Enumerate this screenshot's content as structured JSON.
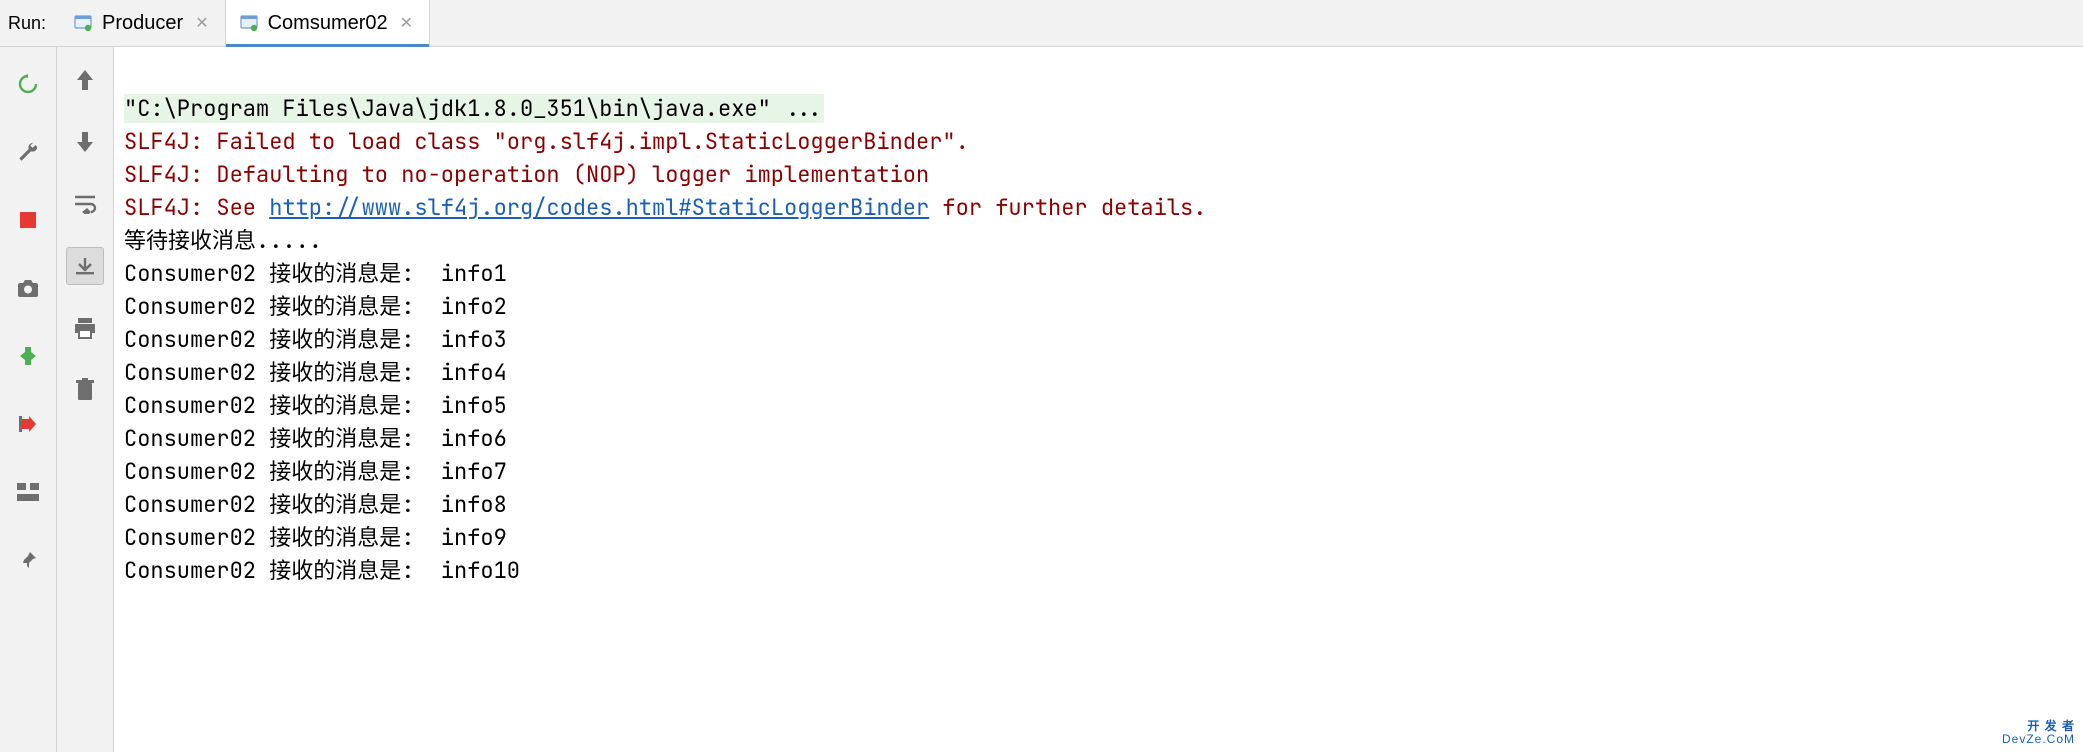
{
  "header": {
    "run_label": "Run:",
    "tabs": [
      {
        "label": "Producer",
        "active": false
      },
      {
        "label": "Comsumer02",
        "active": true
      }
    ]
  },
  "console": {
    "cmd": "\"C:\\Program Files\\Java\\jdk1.8.0_351\\bin\\java.exe\" ...",
    "err1": "SLF4J: Failed to load class \"org.slf4j.impl.StaticLoggerBinder\".",
    "err2": "SLF4J: Defaulting to no-operation (NOP) logger implementation",
    "err3_pre": "SLF4J: See ",
    "err3_link": "http://www.slf4j.org/codes.html#StaticLoggerBinder",
    "err3_post": " for further details.",
    "await": "等待接收消息.....",
    "messages": [
      "Consumer02 接收的消息是:  info1",
      "Consumer02 接收的消息是:  info2",
      "Consumer02 接收的消息是:  info3",
      "Consumer02 接收的消息是:  info4",
      "Consumer02 接收的消息是:  info5",
      "Consumer02 接收的消息是:  info6",
      "Consumer02 接收的消息是:  info7",
      "Consumer02 接收的消息是:  info8",
      "Consumer02 接收的消息是:  info9",
      "Consumer02 接收的消息是:  info10"
    ]
  },
  "watermark": {
    "top": "开 发 者",
    "bottom": "DevZe.CoM"
  },
  "colors": {
    "err": "#8b0000",
    "link": "#1a5fb4",
    "cmd_bg": "#e7f5e6"
  }
}
